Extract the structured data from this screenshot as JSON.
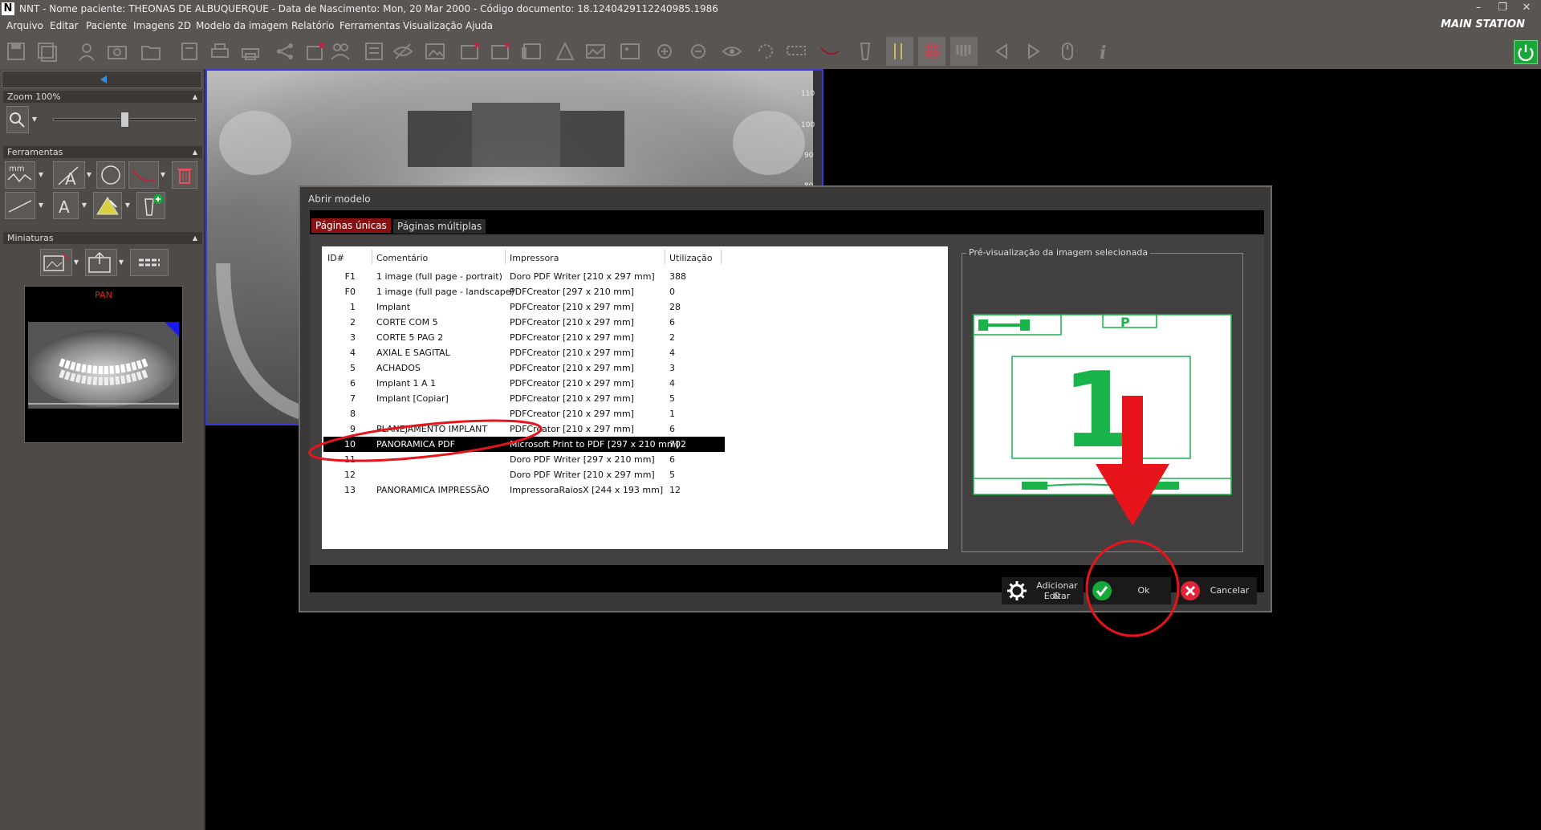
{
  "titlebar": {
    "title": "NNT - Nome paciente: THEONAS DE ALBUQUERQUE - Data de Nascimento: Mon, 20 Mar 2000 - Código documento: 18.1240429112240985.1986",
    "logo": "N",
    "minimize": "–",
    "restore": "❐",
    "close": "✕"
  },
  "menu": [
    "Arquivo",
    "Editar",
    "Paciente",
    "Imagens 2D",
    "Modelo da imagem",
    "Relatório",
    "Ferramentas",
    "Visualização",
    "Ajuda"
  ],
  "station": "MAIN STATION",
  "left_panel": {
    "zoom_label": "Zoom 100%",
    "tools_label": "Ferramentas",
    "thumbs_label": "Miniaturas",
    "thumb_title": "PAN",
    "zoom_level": 0.5,
    "tool_text_mm": "mm",
    "tool_text_a": "A",
    "collapse_arrow": "▲",
    "drop_arrow": "▼"
  },
  "xray": {
    "ruler_labels": [
      "110",
      "100",
      "90",
      "80"
    ]
  },
  "dialog": {
    "title": "Abrir modelo",
    "tabs": {
      "single": "Páginas únicas",
      "multi": "Páginas múltiplas"
    },
    "columns": {
      "id": "ID#",
      "comment": "Comentário",
      "printer": "Impressora",
      "usage": "Utilização"
    },
    "rows": [
      {
        "id": "F1",
        "comment": "1 image (full page - portrait)",
        "printer": "Doro PDF Writer [210 x 297 mm]",
        "usage": "388"
      },
      {
        "id": "F0",
        "comment": "1 image (full page - landscape)",
        "printer": "PDFCreator [297 x 210 mm]",
        "usage": "0"
      },
      {
        "id": "1",
        "comment": "Implant",
        "printer": "PDFCreator [210 x 297 mm]",
        "usage": "28"
      },
      {
        "id": "2",
        "comment": "CORTE COM 5",
        "printer": "PDFCreator [210 x 297 mm]",
        "usage": "6"
      },
      {
        "id": "3",
        "comment": "CORTE 5 PAG 2",
        "printer": "PDFCreator [210 x 297 mm]",
        "usage": "2"
      },
      {
        "id": "4",
        "comment": "AXIAL E SAGITAL",
        "printer": "PDFCreator [210 x 297 mm]",
        "usage": "4"
      },
      {
        "id": "5",
        "comment": "ACHADOS",
        "printer": "PDFCreator [210 x 297 mm]",
        "usage": "3"
      },
      {
        "id": "6",
        "comment": "Implant 1 A 1",
        "printer": "PDFCreator [210 x 297 mm]",
        "usage": "4"
      },
      {
        "id": "7",
        "comment": "Implant [Copiar]",
        "printer": "PDFCreator [210 x 297 mm]",
        "usage": "5"
      },
      {
        "id": "8",
        "comment": "",
        "printer": "PDFCreator [210 x 297 mm]",
        "usage": "1"
      },
      {
        "id": "9",
        "comment": "PLANEJAMENTO IMPLANT",
        "printer": "PDFCreator [210 x 297 mm]",
        "usage": "6"
      },
      {
        "id": "10",
        "comment": "PANORAMICA PDF",
        "printer": "Microsoft Print to PDF [297 x 210 mm]",
        "usage": "702"
      },
      {
        "id": "11",
        "comment": "",
        "printer": "Doro PDF Writer [297 x 210 mm]",
        "usage": "6"
      },
      {
        "id": "12",
        "comment": "",
        "printer": "Doro PDF Writer [210 x 297 mm]",
        "usage": "5"
      },
      {
        "id": "13",
        "comment": "PANORAMICA IMPRESSÃO",
        "printer": "ImpressoraRaiosX [244 x 193 mm]",
        "usage": "12"
      }
    ],
    "selected_row_id": "10",
    "preview_title": "Pré-visualização da imagem selecionada",
    "preview_number": "1",
    "preview_letter": "P",
    "buttons": {
      "add_edit_1": "Adicionar &",
      "add_edit_2": "Editar",
      "ok": "Ok",
      "cancel": "Cancelar"
    }
  },
  "colors": {
    "chrome": "#595553",
    "selected_tab": "#8b1111",
    "annotation_red": "#e8141c",
    "ok_green": "#18a83a",
    "cancel_red": "#e0243a",
    "preview_green": "#1ab34a"
  }
}
